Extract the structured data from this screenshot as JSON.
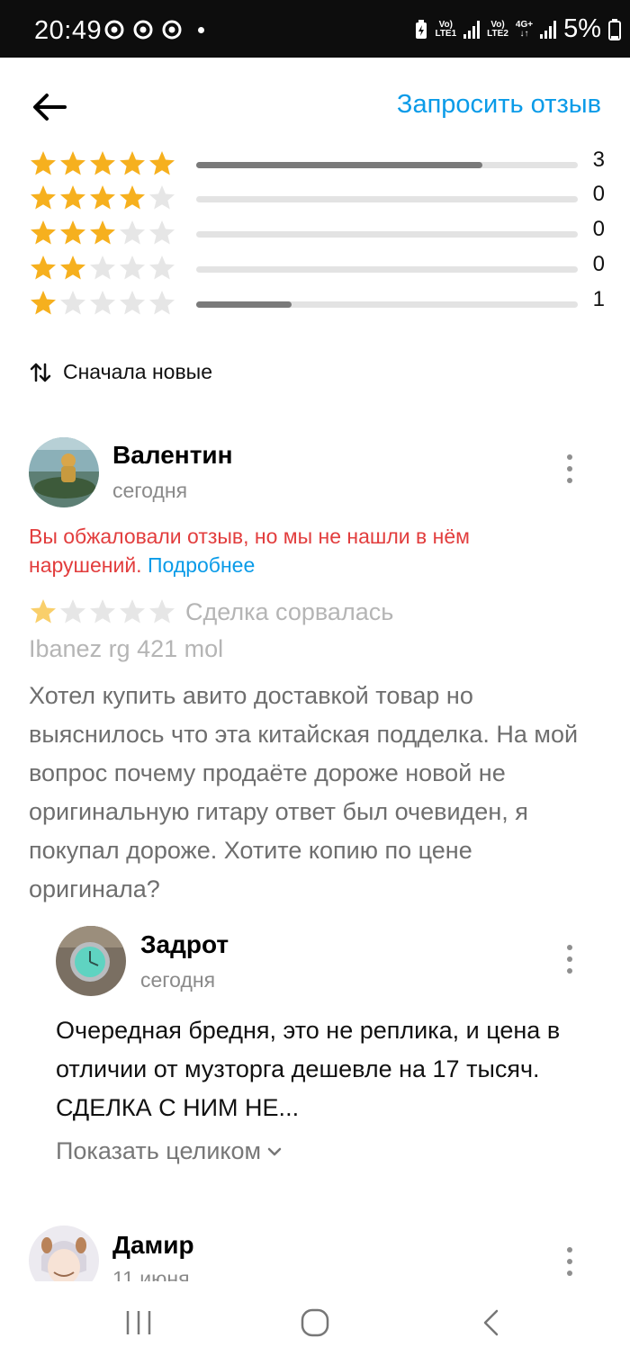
{
  "status_bar": {
    "time": "20:49",
    "sim1_top": "Vo)",
    "sim1_bottom": "LTE1",
    "sim2_top": "Vo)",
    "sim2_bottom": "LTE2",
    "net_type": "4G+",
    "battery": "5%"
  },
  "header": {
    "back_icon": "arrow-left-icon",
    "request_review_label": "Запросить отзыв"
  },
  "rating_summary": {
    "star_color": "#f6b01e",
    "rows": [
      {
        "stars": 5,
        "count": "3",
        "fill_fraction": 0.75
      },
      {
        "stars": 4,
        "count": "0",
        "fill_fraction": 0
      },
      {
        "stars": 3,
        "count": "0",
        "fill_fraction": 0
      },
      {
        "stars": 2,
        "count": "0",
        "fill_fraction": 0
      },
      {
        "stars": 1,
        "count": "1",
        "fill_fraction": 0.25
      }
    ]
  },
  "sort": {
    "icon": "sort-arrows-icon",
    "label": "Сначала новые"
  },
  "reviews": [
    {
      "author": "Валентин",
      "date": "сегодня",
      "warning_text": "Вы обжаловали отзыв, но мы не нашли в нём нарушений.",
      "warning_link": "Подробнее",
      "rating": 1,
      "deal_status": "Сделка сорвалась",
      "product": "Ibanez rg 421 mol",
      "text": "Хотел купить авито доставкой товар но выяснилось что эта китайская подделка. На мой вопрос почему продаёте дороже новой не оригинальную гитару ответ был очевиден, я покупал дороже. Хотите копию по цене оригинала?",
      "reply": {
        "author": "Задрот",
        "date": "сегодня",
        "text": "Очередная бредня, это не реплика, и цена в отличии от музторга дешевле на 17 тысяч. СДЕЛКА С НИМ НЕ...",
        "show_full_label": "Показать целиком"
      }
    },
    {
      "author": "Дамир",
      "date": "11 июня"
    }
  ],
  "nav_bar": {
    "recents_icon": "recents-icon",
    "home_icon": "home-icon",
    "back_icon": "nav-back-icon"
  }
}
